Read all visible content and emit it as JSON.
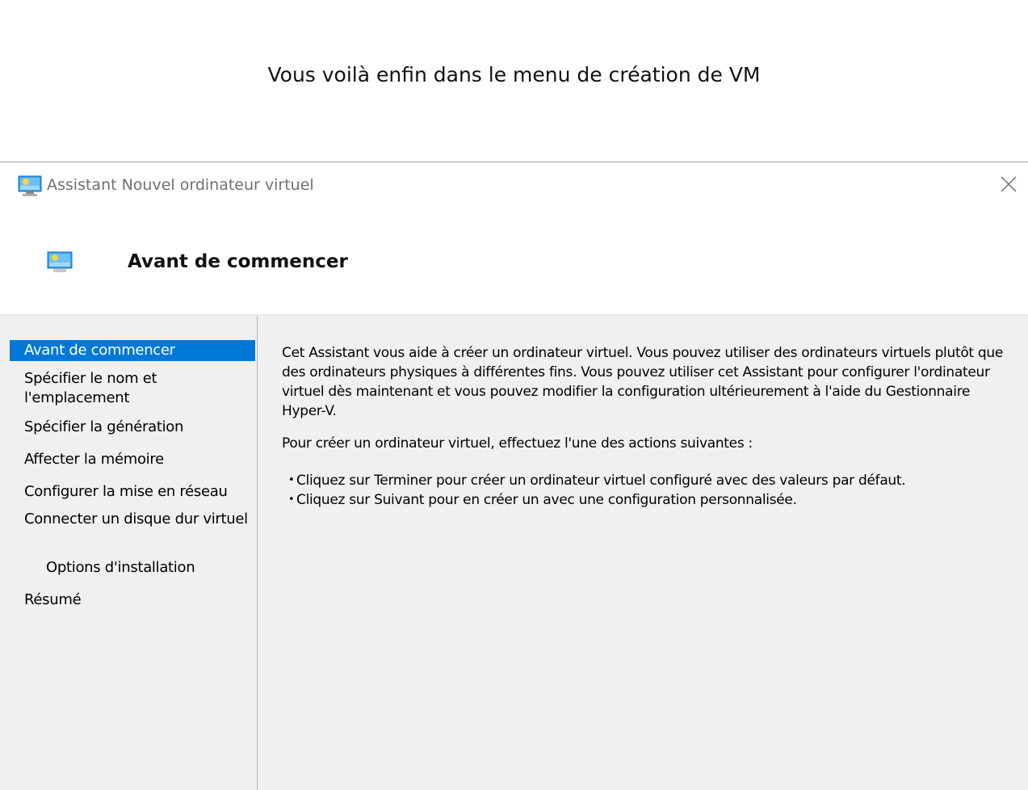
{
  "caption": "Vous voilà enfin dans le menu de création de VM",
  "window": {
    "title": "Assistant Nouvel ordinateur virtuel",
    "icon": "vm-monitor-icon",
    "close_icon": "close-icon"
  },
  "header": {
    "title": "Avant de commencer"
  },
  "nav": {
    "items": [
      {
        "label": "Avant de commencer",
        "active": true
      },
      {
        "label": "Spécifier le nom et l'emplacement"
      },
      {
        "label": "Spécifier la génération"
      },
      {
        "label": "Affecter la mémoire"
      },
      {
        "label": "Configurer la mise en réseau"
      },
      {
        "label": "Connecter un disque dur virtuel"
      },
      {
        "label": "Options d'installation",
        "sub": true
      },
      {
        "label": "Résumé"
      }
    ]
  },
  "content": {
    "intro": "Cet Assistant vous aide à créer un ordinateur virtuel. Vous pouvez utiliser des ordinateurs virtuels plutôt que des ordinateurs physiques à différentes fins. Vous pouvez utiliser cet Assistant pour configurer l'ordinateur virtuel dès maintenant et vous pouvez modifier la configuration ultérieurement à l'aide du Gestionnaire Hyper-V.",
    "actions_intro": "Pour créer un ordinateur virtuel, effectuez l'une des actions suivantes :",
    "bullets": [
      "Cliquez sur Terminer pour créer un ordinateur virtuel configuré avec des valeurs par défaut.",
      "Cliquez sur Suivant pour en créer un avec une configuration personnalisée."
    ]
  },
  "colors": {
    "selection": "#0078d7",
    "body_bg": "#f0f0f0",
    "title_text": "#707070"
  }
}
